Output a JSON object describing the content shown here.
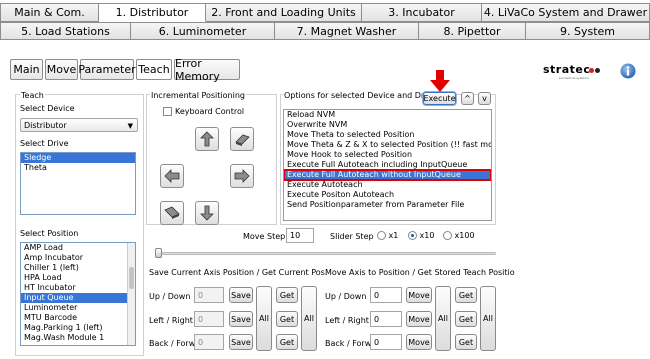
{
  "top_tabs_row1": [
    "Main & Com.",
    "1. Distributor",
    "2. Front and Loading Units",
    "3. Incubator",
    "4. LiVaCo System and Drawer"
  ],
  "top_tabs_row2": [
    "5. Load Stations",
    "6. Luminometer",
    "7. Magnet Washer",
    "8. Pipettor",
    "9. System"
  ],
  "active_top_tab": "1. Distributor",
  "sub_tabs": [
    "Main",
    "Move",
    "Parameter",
    "Teach",
    "Error Memory"
  ],
  "active_sub_tab": "Teach",
  "logo": {
    "text": "stratec",
    "tagline": "biomedical systems"
  },
  "teach": {
    "group_title": "Teach",
    "select_device_label": "Select Device",
    "device_value": "Distributor",
    "select_drive_label": "Select Drive",
    "drives": [
      "Sledge",
      "Theta"
    ],
    "selected_drive": "Sledge",
    "select_position_label": "Select Position",
    "positions": [
      "AMP Load",
      "Amp Incubator",
      "Chiller 1 (left)",
      "HPA Load",
      "HT Incubator",
      "Input Queue",
      "Luminometer",
      "MTU Barcode",
      "Mag.Parking 1 (left)",
      "Mag.Wash Module 1"
    ],
    "selected_position": "Input Queue"
  },
  "incremental": {
    "title": "Incremental Positioning",
    "keyboard_control_label": "Keyboard Control",
    "move_step_label": "Move Step",
    "move_step_value": "10",
    "slider_step_label": "Slider Step",
    "slider_options": [
      "x1",
      "x10",
      "x100"
    ],
    "slider_selected": "x10"
  },
  "options": {
    "title": "Options for selected Device and Drive",
    "execute_label": "Execute",
    "up_label": "^",
    "down_label": "v",
    "items": [
      "Reload NVM",
      "Overwrite NVM",
      "Move Theta to selected Position",
      "Move Theta & Z & X to selected Position (!! fast move !!)",
      "Move Hook to selected Position",
      "Execute Full Autoteach including InputQueue",
      "Execute Full Autoteach without InputQueue",
      "Execute Autoteach",
      "Execute Positon Autoteach",
      "Send Positionparameter from Parameter File"
    ],
    "selected_item": "Execute Full Autoteach without InputQueue"
  },
  "save_section": {
    "title": "Save Current Axis Position / Get Current Pos.",
    "rows": [
      {
        "label": "Up / Down",
        "value": "0"
      },
      {
        "label": "Left / Right",
        "value": "0"
      },
      {
        "label": "Back / Forw.",
        "value": "0"
      }
    ],
    "save_label": "Save",
    "get_label": "Get",
    "all_label": "All"
  },
  "move_section": {
    "title": "Move Axis to Position / Get Stored Teach Positio",
    "rows": [
      {
        "label": "Up / Down",
        "value": "0"
      },
      {
        "label": "Left / Right",
        "value": "0"
      },
      {
        "label": "Back / Forw.",
        "value": "0"
      }
    ],
    "move_label": "Move",
    "get_label": "Get",
    "all_label": "All"
  },
  "colors": {
    "selection": "#3875d7",
    "highlight_outline": "#e00000",
    "arrow": "#e00000"
  }
}
